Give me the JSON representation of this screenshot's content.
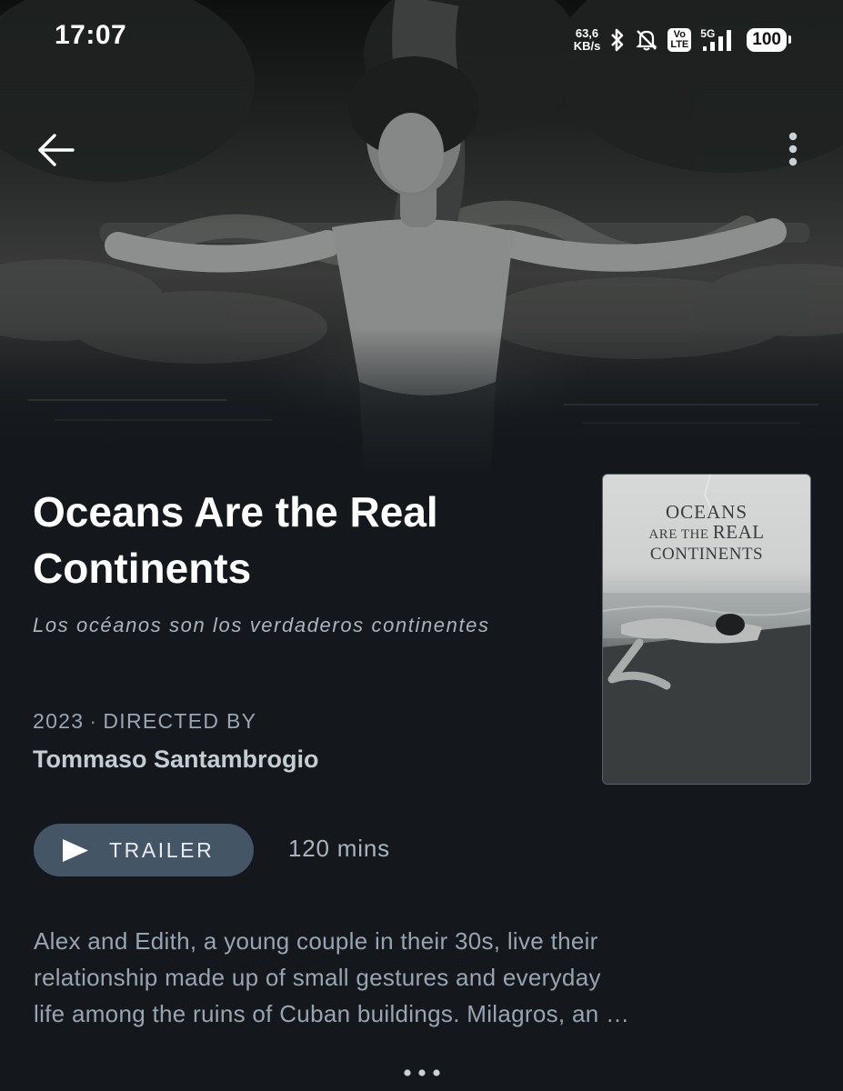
{
  "status_bar": {
    "time": "17:07",
    "net_speed_value": "63,6",
    "net_speed_unit": "KB/s",
    "volte_line1": "Vo",
    "volte_line2": "LTE",
    "network_type": "5G",
    "battery": "100",
    "icons": [
      "bluetooth-icon",
      "bell-muted-icon",
      "signal-icon"
    ]
  },
  "header": {
    "back_icon": "arrow-left-icon",
    "menu_icon": "more-vertical-icon"
  },
  "film": {
    "title": "Oceans Are the Real Continents",
    "original_title": "Los océanos son los verdaderos continentes",
    "year": "2023",
    "separator": "·",
    "directed_by_label": "DIRECTED BY",
    "director": "Tommaso Santambrogio",
    "runtime": "120 mins"
  },
  "poster": {
    "title_line1": "OCEANS",
    "title_line2_small": "ARE THE",
    "title_line2_big": "REAL",
    "title_line3": "CONTINENTS"
  },
  "trailer": {
    "label": "TRAILER",
    "icon": "play-icon"
  },
  "synopsis": {
    "lines": [
      "Alex and Edith, a young couple in their 30s, live their",
      "relationship made up of small gestures and everyday",
      "life among the ruins of Cuban buildings. Milagros, an …"
    ],
    "more_icon": "more-horizontal-icon"
  },
  "colors": {
    "background": "#14181c",
    "trailer_button": "#445566",
    "muted_text": "#98a4b1",
    "director_text": "#c4ccd4"
  }
}
